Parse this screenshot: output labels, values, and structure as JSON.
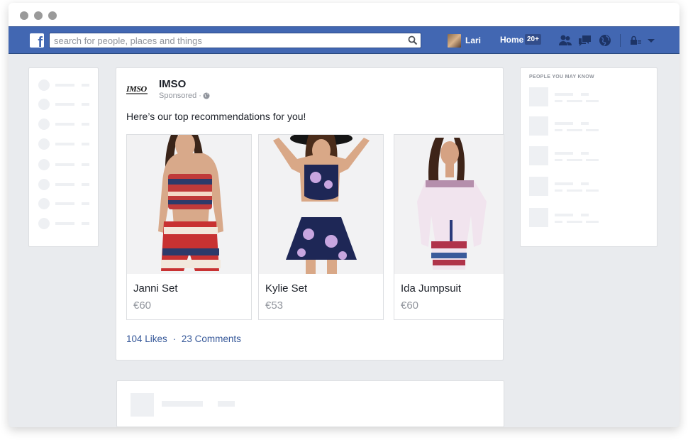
{
  "header": {
    "search_placeholder": "search for people, places and things",
    "user_name": "Lari",
    "home_label": "Home",
    "home_badge": "20+",
    "icons": [
      "facebook-logo-icon",
      "search-icon",
      "friend-requests-icon",
      "messages-icon",
      "notifications-globe-icon",
      "privacy-lock-icon",
      "chevron-down-icon"
    ]
  },
  "post": {
    "brand": "IMSO",
    "logo_text": "IMSO",
    "sponsored": "Sponsored",
    "separator": "·",
    "text": "Here’s our top recommendations for you!",
    "products": [
      {
        "title": "Janni Set",
        "price": "€60"
      },
      {
        "title": "Kylie Set",
        "price": "€53"
      },
      {
        "title": "Ida Jumpsuit",
        "price": "€60"
      }
    ],
    "likes": "104 Likes",
    "meta_sep": "·",
    "comments": "23 Comments"
  },
  "sidebar_right": {
    "title": "PEOPLE YOU MAY KNOW"
  },
  "colors": {
    "nav_blue": "#4267b2",
    "link_blue": "#365899",
    "page_bg": "#e9ebee"
  }
}
